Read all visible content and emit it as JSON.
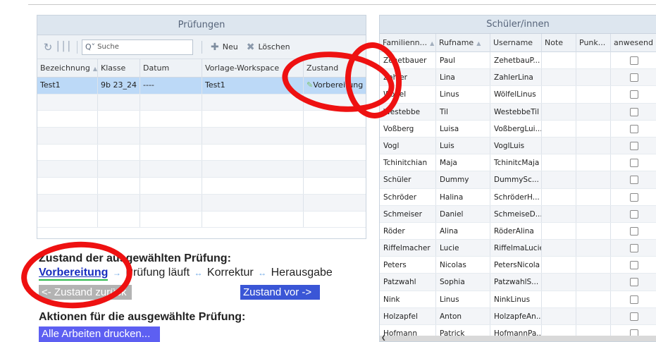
{
  "exams_panel": {
    "title": "Prüfungen",
    "toolbar": {
      "refresh_icon": "refresh-icon",
      "columns_icon": "columns-icon",
      "search_placeholder": "Suche",
      "new_label": "Neu",
      "delete_label": "Löschen"
    },
    "columns": [
      "Bezeichnung",
      "Klasse",
      "Datum",
      "Vorlage-Workspace",
      "Zustand"
    ],
    "rows": [
      {
        "bezeichnung": "Test1",
        "klasse": "9b 23_24",
        "datum": "----",
        "vorlage": "Test1",
        "zustand": "Vorbereitung"
      }
    ]
  },
  "status_section": {
    "title": "Zustand der ausgewählten Prüfung:",
    "steps": [
      "Vorbereitung",
      "Prüfung läuft",
      "Korrektur",
      "Herausgabe"
    ],
    "active_step": "Vorbereitung",
    "back_button": "<- Zustand zurück",
    "forward_button": "Zustand vor ->"
  },
  "actions_section": {
    "title": "Aktionen für die ausgewählte Prüfung:",
    "print_button": "Alle Arbeiten drucken..."
  },
  "students_panel": {
    "title": "Schüler/innen",
    "columns": [
      "Familienn...",
      "Rufname",
      "Username",
      "Note",
      "Punk...",
      "anwesend"
    ],
    "rows": [
      {
        "familienname": "Zehetbauer",
        "rufname": "Paul",
        "username": "ZehetbauP...",
        "note": "",
        "punkte": "",
        "anwesend": false
      },
      {
        "familienname": "Zahler",
        "rufname": "Lina",
        "username": "ZahlerLina",
        "note": "",
        "punkte": "",
        "anwesend": false
      },
      {
        "familienname": "Wölfel",
        "rufname": "Linus",
        "username": "WölfelLinus",
        "note": "",
        "punkte": "",
        "anwesend": false
      },
      {
        "familienname": "Westebbe",
        "rufname": "Til",
        "username": "WestebbeTil",
        "note": "",
        "punkte": "",
        "anwesend": false
      },
      {
        "familienname": "Voßberg",
        "rufname": "Luisa",
        "username": "VoßbergLui...",
        "note": "",
        "punkte": "",
        "anwesend": false
      },
      {
        "familienname": "Vogl",
        "rufname": "Luis",
        "username": "VoglLuis",
        "note": "",
        "punkte": "",
        "anwesend": false
      },
      {
        "familienname": "Tchinitchian",
        "rufname": "Maja",
        "username": "TchinitcMaja",
        "note": "",
        "punkte": "",
        "anwesend": false
      },
      {
        "familienname": "Schüler",
        "rufname": "Dummy",
        "username": "DummySc...",
        "note": "",
        "punkte": "",
        "anwesend": false
      },
      {
        "familienname": "Schröder",
        "rufname": "Halina",
        "username": "SchröderH...",
        "note": "",
        "punkte": "",
        "anwesend": false
      },
      {
        "familienname": "Schmeiser",
        "rufname": "Daniel",
        "username": "SchmeiseD...",
        "note": "",
        "punkte": "",
        "anwesend": false
      },
      {
        "familienname": "Röder",
        "rufname": "Alina",
        "username": "RöderAlina",
        "note": "",
        "punkte": "",
        "anwesend": false
      },
      {
        "familienname": "Riffelmacher",
        "rufname": "Lucie",
        "username": "RiffelmaLucie",
        "note": "",
        "punkte": "",
        "anwesend": false
      },
      {
        "familienname": "Peters",
        "rufname": "Nicolas",
        "username": "PetersNicola",
        "note": "",
        "punkte": "",
        "anwesend": false
      },
      {
        "familienname": "Patzwahl",
        "rufname": "Sophia",
        "username": "PatzwahlS...",
        "note": "",
        "punkte": "",
        "anwesend": false
      },
      {
        "familienname": "Nink",
        "rufname": "Linus",
        "username": "NinkLinus",
        "note": "",
        "punkte": "",
        "anwesend": false
      },
      {
        "familienname": "Holzapfel",
        "rufname": "Anton",
        "username": "HolzapfeAn...",
        "note": "",
        "punkte": "",
        "anwesend": false
      },
      {
        "familienname": "Hofmann",
        "rufname": "Patrick",
        "username": "HofmannPa...",
        "note": "",
        "punkte": "",
        "anwesend": false
      }
    ]
  },
  "colors": {
    "annotation_red": "#ee1111",
    "selected_row": "#bcd9f7",
    "forward_button": "#3a56d6",
    "print_button": "#5d5ff2",
    "disabled_button": "#b3b3b3",
    "active_step": "#1a2fbf"
  }
}
